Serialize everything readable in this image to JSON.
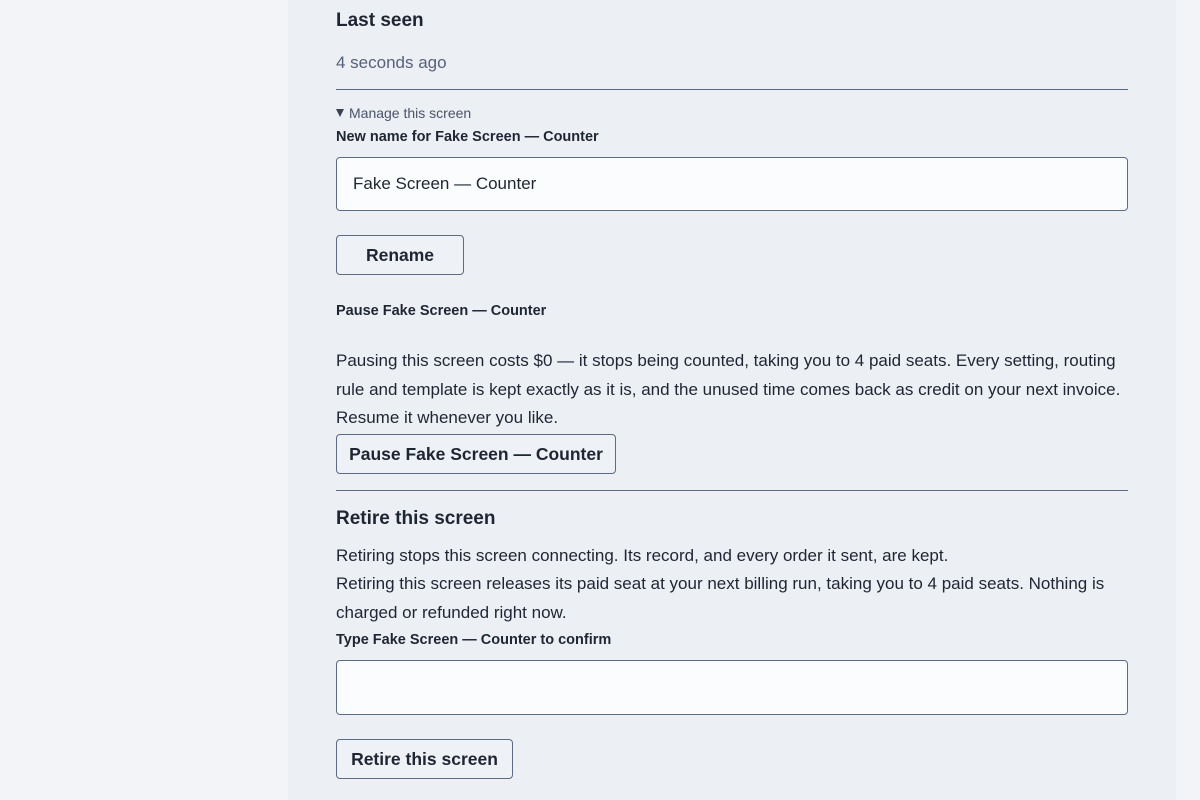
{
  "last_seen": {
    "heading": "Last seen",
    "value": "4 seconds ago"
  },
  "manage": {
    "summary": "Manage this screen",
    "rename_label": "New name for Fake Screen — Counter",
    "rename_value": "Fake Screen — Counter",
    "rename_button": "Rename",
    "pause_label": "Pause Fake Screen — Counter",
    "pause_description": "Pausing this screen costs $0 — it stops being counted, taking you to 4 paid seats. Every setting, routing rule and template is kept exactly as it is, and the unused time comes back as credit on your next invoice. Resume it whenever you like.",
    "pause_button": "Pause Fake Screen — Counter"
  },
  "retire": {
    "heading": "Retire this screen",
    "description_1": "Retiring stops this screen connecting. Its record, and every order it sent, are kept.",
    "description_2": "Retiring this screen releases its paid seat at your next billing run, taking you to 4 paid seats. Nothing is charged or refunded right now.",
    "confirm_label": "Type Fake Screen — Counter to confirm",
    "confirm_value": "",
    "button": "Retire this screen"
  }
}
